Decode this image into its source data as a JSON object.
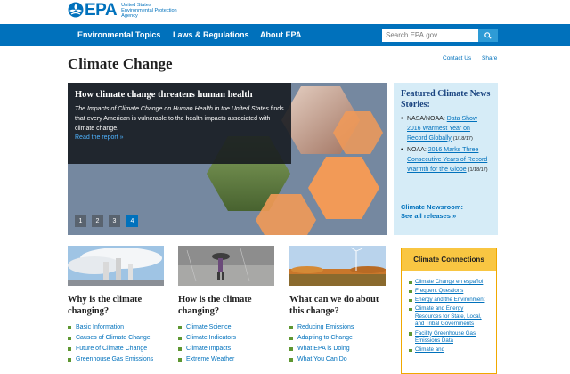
{
  "header": {
    "logo_text": "EPA",
    "agency_line1": "United States",
    "agency_line2": "Environmental Protection",
    "agency_line3": "Agency"
  },
  "nav": {
    "items": [
      {
        "label": "Environmental Topics"
      },
      {
        "label": "Laws & Regulations"
      },
      {
        "label": "About EPA"
      }
    ],
    "search_placeholder": "Search EPA.gov",
    "search_icon": "search-icon"
  },
  "page": {
    "title": "Climate Change",
    "contact_us": "Contact Us",
    "share": "Share"
  },
  "hero": {
    "title": "How climate change threatens human health",
    "body_italic": "The Impacts of Climate Change on Human Health in the United States",
    "body_rest": " finds that every American is vulnerable to the health impacts associated with climate change.",
    "link": "Read the report »",
    "pages": [
      "1",
      "2",
      "3",
      "4"
    ],
    "active_page": "4"
  },
  "featured": {
    "title": "Featured Climate News Stories:",
    "items": [
      {
        "prefix": "NASA/NOAA: ",
        "link": "Data Show 2016 Warmest Year on Record Globally",
        "date": "(1/18/17)"
      },
      {
        "prefix": "NOAA: ",
        "link": "2016 Marks Three Consecutive Years of Record Warmth for the Globe",
        "date": "(1/18/17)"
      }
    ],
    "newsroom_line1": "Climate Newsroom:",
    "newsroom_line2": "See all releases »"
  },
  "columns": [
    {
      "title": "Why is the climate changing?",
      "links": [
        "Basic Information",
        "Causes of Climate Change",
        "Future of Climate Change",
        "Greenhouse Gas Emissions"
      ]
    },
    {
      "title": "How is the climate changing?",
      "links": [
        "Climate Science",
        "Climate Indicators",
        "Climate Impacts",
        "Extreme Weather"
      ]
    },
    {
      "title": "What can we do about this change?",
      "links": [
        "Reducing Emissions",
        "Adapting to Change",
        "What EPA is Doing",
        "What You Can Do"
      ]
    }
  ],
  "connections": {
    "title": "Climate Connections",
    "items": [
      "Climate Change en español",
      "Frequent Questions",
      "Energy and the Environment",
      "Climate and Energy Resources for State, Local, and Tribal Governments",
      "Facility Greenhouse Gas Emissions Data",
      "Climate and"
    ]
  },
  "colors": {
    "epa_blue": "#0071bc",
    "nav_blue": "#0071bc",
    "featured_bg": "#d6ecf7",
    "connections_header": "#f9c642",
    "bullet_green": "#5e9732"
  }
}
